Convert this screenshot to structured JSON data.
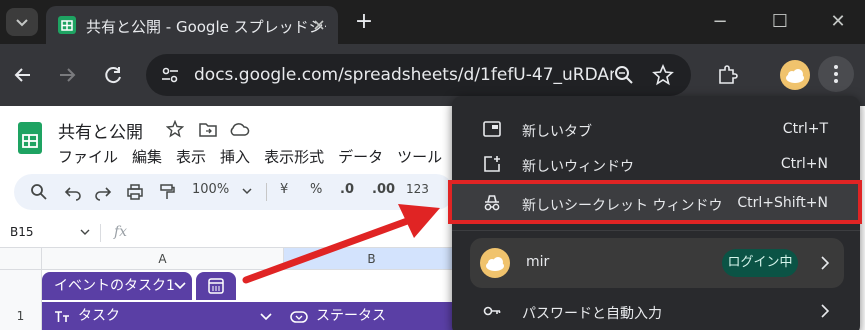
{
  "browser": {
    "tab_title": "共有と公開 - Google スプレッドシー",
    "new_tab_symbol": "+",
    "url": "docs.google.com/spreadsheets/d/1fefU-47_uRDAn...",
    "window_controls": [
      "−",
      "☐",
      "✕"
    ]
  },
  "sheets": {
    "doc_title": "共有と公開",
    "menu": [
      "ファイル",
      "編集",
      "表示",
      "挿入",
      "表示形式",
      "データ",
      "ツール"
    ],
    "toolbar": {
      "zoom": "100%",
      "currency": "¥",
      "percent": "%",
      "dec_decrease": ".0",
      "dec_increase": ".00",
      "number_format": "123"
    },
    "namebox": "B15",
    "fx": "fx",
    "columns": [
      "A",
      "B"
    ],
    "rows": [
      "1"
    ],
    "table_name": "イベントのタスク1",
    "col_task": "タスク",
    "col_status": "ステータス"
  },
  "chrome_menu": {
    "items": [
      {
        "label": "新しいタブ",
        "shortcut": "Ctrl+T"
      },
      {
        "label": "新しいウィンドウ",
        "shortcut": "Ctrl+N"
      },
      {
        "label": "新しいシークレット ウィンドウ",
        "shortcut": "Ctrl+Shift+N"
      }
    ],
    "profile": {
      "name": "mir",
      "status": "ログイン中"
    },
    "passwords": "パスワードと自動入力"
  },
  "colors": {
    "accent_red": "#e02424",
    "sheets_green": "#1ea362",
    "table_purple": "#5a3fa5"
  }
}
